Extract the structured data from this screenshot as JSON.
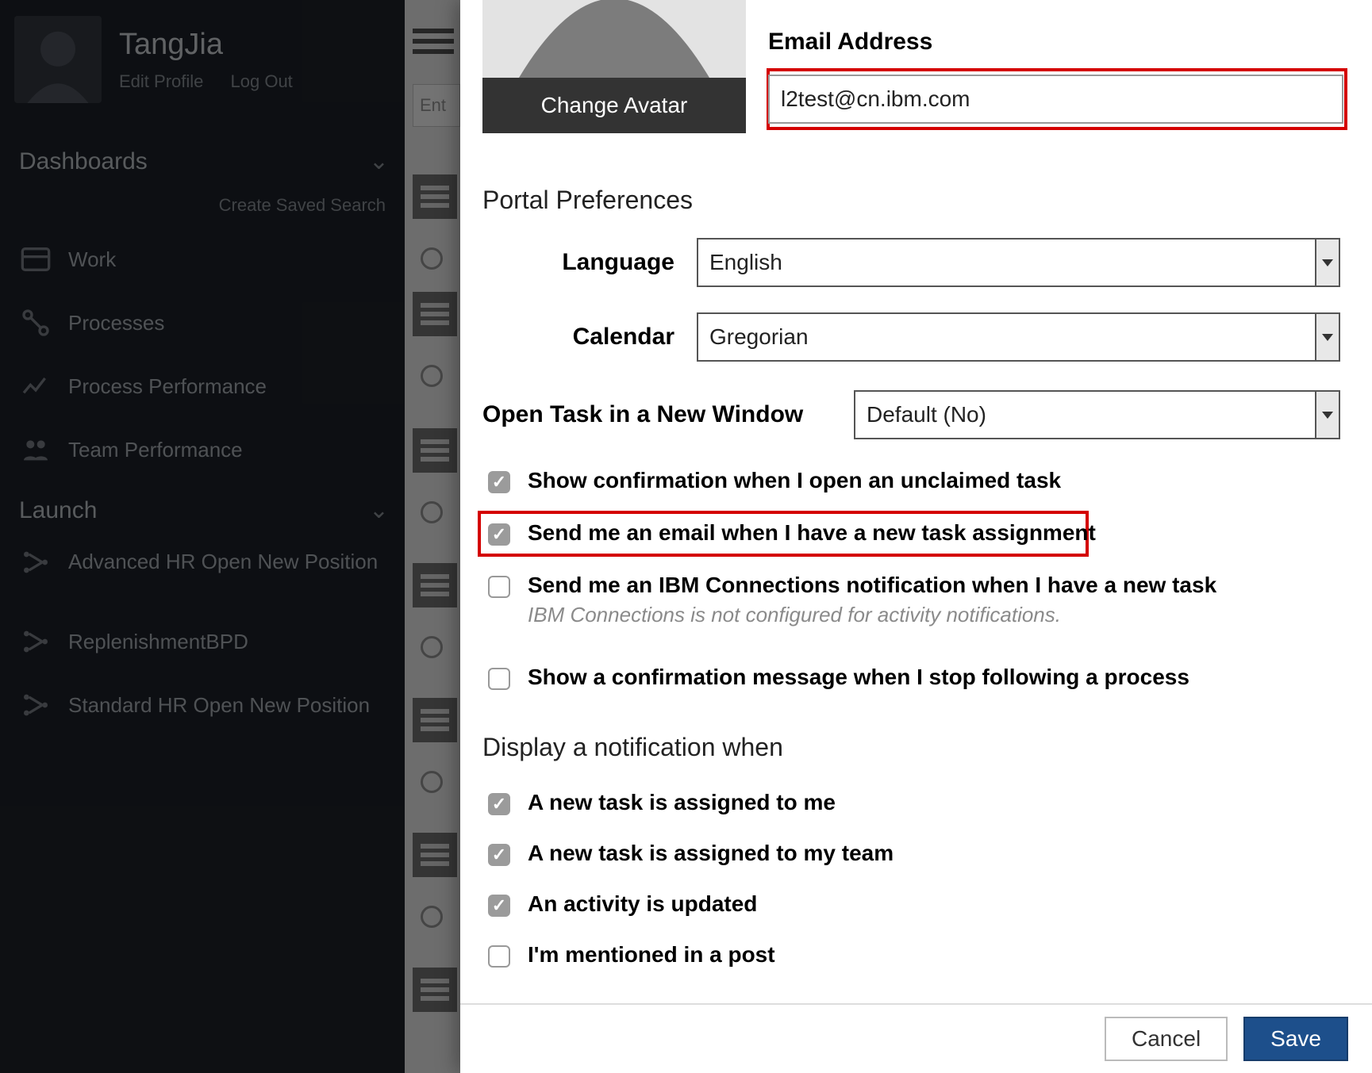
{
  "sidebar": {
    "user_name": "TangJia",
    "edit_profile_label": "Edit Profile",
    "log_out_label": "Log Out",
    "dashboards_header": "Dashboards",
    "create_saved_search_label": "Create Saved Search",
    "items": [
      {
        "label": "Work"
      },
      {
        "label": "Processes"
      },
      {
        "label": "Process Performance"
      },
      {
        "label": "Team Performance"
      }
    ],
    "launch_header": "Launch",
    "launch_items": [
      {
        "label": "Advanced HR Open New Position"
      },
      {
        "label": "ReplenishmentBPD"
      },
      {
        "label": "Standard HR Open New Position"
      }
    ]
  },
  "strip": {
    "search_placeholder": "Ent"
  },
  "modal": {
    "change_avatar_label": "Change Avatar",
    "email_label": "Email Address",
    "email_value": "l2test@cn.ibm.com",
    "portal_prefs_title": "Portal Preferences",
    "language_label": "Language",
    "language_value": "English",
    "calendar_label": "Calendar",
    "calendar_value": "Gregorian",
    "open_task_label": "Open Task in a New Window",
    "open_task_value": "Default (No)",
    "checks": {
      "confirm_unclaimed": "Show confirmation when I open an unclaimed task",
      "email_new_task": "Send me an email when I have a new task assignment",
      "ibm_conn_notify": "Send me an IBM Connections notification when I have a new task",
      "ibm_conn_hint": "IBM Connections is not configured for activity notifications.",
      "confirm_stop_follow": "Show a confirmation message when I stop following a process"
    },
    "notif_title": "Display a notification when",
    "notifs": {
      "task_me": "A new task is assigned to me",
      "task_team": "A new task is assigned to my team",
      "activity_updated": "An activity is updated",
      "mentioned": "I'm mentioned in a post"
    },
    "cancel_label": "Cancel",
    "save_label": "Save"
  },
  "state": {
    "checks": {
      "confirm_unclaimed": true,
      "email_new_task": true,
      "ibm_conn_notify": false,
      "confirm_stop_follow": false
    },
    "notifs": {
      "task_me": true,
      "task_team": true,
      "activity_updated": true,
      "mentioned": false
    }
  },
  "colors": {
    "highlight": "#d40000",
    "primary": "#1d4f8b"
  }
}
